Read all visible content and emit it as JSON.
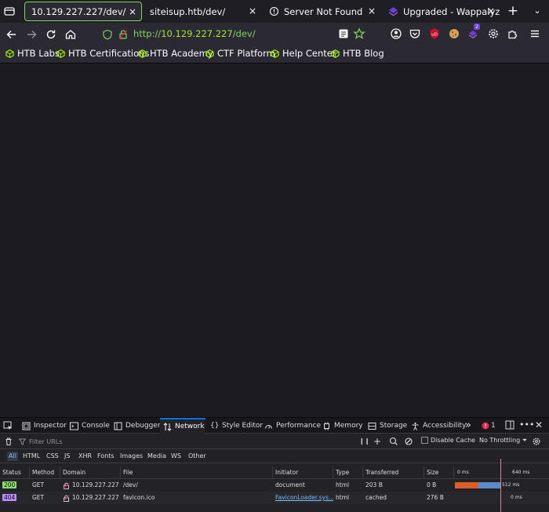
{
  "tabs": [
    {
      "title": "10.129.227.227/dev/",
      "close": "×"
    },
    {
      "title": "siteisup.htb/dev/",
      "close": "×"
    },
    {
      "title": "Server Not Found",
      "close": "×"
    },
    {
      "title": "Upgraded - Wappalyzer",
      "close": "×"
    }
  ],
  "new_tab_label": "+",
  "tab_overflow_label": "⌄",
  "url": {
    "scheme": "http://",
    "host": "10.129.227.227",
    "path": "/dev/"
  },
  "extension_badge": "2",
  "extension_ub_label": "uD",
  "bookmarks": [
    "HTB Labs",
    "HTB Certifications",
    "HTB Academy",
    "CTF Platform",
    "Help Center",
    "HTB Blog"
  ],
  "devtools": {
    "tabs": [
      "Inspector",
      "Console",
      "Debugger",
      "Network",
      "Style Editor",
      "Performance",
      "Memory",
      "Storage",
      "Accessibility"
    ],
    "active_tab": "Network",
    "more_label": "»",
    "error_count": "1",
    "filter_placeholder": "Filter URLs",
    "pause_label": "❙❙",
    "disable_cache_label": "Disable Cache",
    "throttling_label": "No Throttling ⏷",
    "type_filters": [
      "All",
      "HTML",
      "CSS",
      "JS",
      "XHR",
      "Fonts",
      "Images",
      "Media",
      "WS",
      "Other"
    ],
    "active_type": "All",
    "columns": [
      "Status",
      "Method",
      "Domain",
      "File",
      "Initiator",
      "Type",
      "Transferred",
      "Size"
    ],
    "timeline_labels": [
      "0 ms",
      "640 ms"
    ],
    "rows": [
      {
        "status": "200",
        "method": "GET",
        "domain": "10.129.227.227",
        "file": "/dev/",
        "initiator": "document",
        "type": "html",
        "transferred": "203 B",
        "size": "0 B",
        "timing": "512 ms"
      },
      {
        "status": "404",
        "method": "GET",
        "domain": "10.129.227.227",
        "file": "favicon.ico",
        "initiator": "FaviconLoader.sys...",
        "type": "html",
        "transferred": "cached",
        "size": "276 B",
        "timing": "0 ms"
      }
    ]
  },
  "colors": {
    "accent_green": "#7fd45a",
    "status_200": "#86de74",
    "status_404": "#b98eff",
    "devtools_active": "#0074e8",
    "error_red": "#e22850",
    "waterfall_blocked": "#d95e28",
    "waterfall_receive": "#5b8bcb"
  }
}
